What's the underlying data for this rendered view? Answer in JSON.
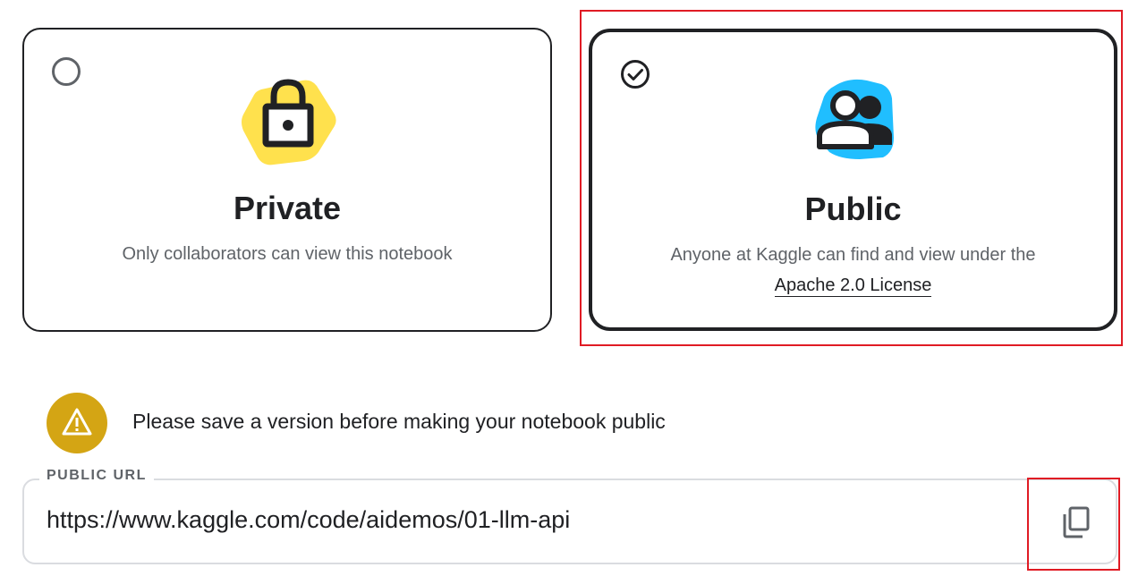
{
  "visibility": {
    "private": {
      "title": "Private",
      "description": "Only collaborators can view this notebook",
      "selected": false
    },
    "public": {
      "title": "Public",
      "description": "Anyone at Kaggle can find and view under the",
      "license_link": "Apache 2.0 License",
      "selected": true
    }
  },
  "warning": {
    "message": "Please save a version before making your notebook public"
  },
  "public_url": {
    "label": "PUBLIC URL",
    "value": "https://www.kaggle.com/code/aidemos/01-llm-api"
  },
  "colors": {
    "lock_blob": "#ffe14d",
    "people_blob": "#20beff",
    "warning": "#d4a514",
    "highlight": "#e01b24"
  },
  "icons": {
    "private_radio": "radio-unchecked-icon",
    "public_radio": "check-circle-icon",
    "private": "lock-icon",
    "public": "people-icon",
    "warning": "warning-icon",
    "copy": "copy-icon"
  }
}
